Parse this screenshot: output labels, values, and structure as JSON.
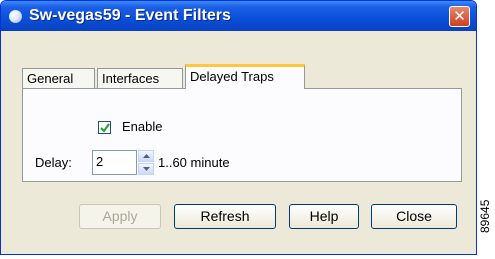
{
  "window": {
    "title": "Sw-vegas59 - Event Filters",
    "close_glyph": "✕",
    "icon": "app-icon"
  },
  "tabs": [
    {
      "label": "General"
    },
    {
      "label": "Interfaces"
    },
    {
      "label": "Delayed Traps"
    }
  ],
  "delayed_traps": {
    "enable_label": "Enable",
    "enable_checked": true,
    "delay_label": "Delay:",
    "delay_value": "2",
    "delay_range": "1..60 minute"
  },
  "buttons": {
    "apply": "Apply",
    "refresh": "Refresh",
    "help": "Help",
    "close": "Close"
  },
  "side_code": "89645",
  "colors": {
    "titlebar": "#0a4fd9",
    "active_tab_accent": "#ffc83c",
    "dialog_bg": "#ece9d8"
  }
}
